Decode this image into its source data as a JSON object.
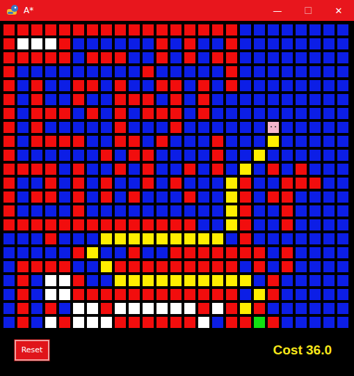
{
  "window": {
    "title": "A*",
    "controls": [
      "—",
      "☐",
      "✕"
    ]
  },
  "grid": {
    "legend": {
      "R": "wall",
      "B": "open",
      "Y": "path",
      "W": "visited",
      "S": "start",
      "E": "end"
    },
    "rows": [
      "RRRRRRRRRRRRRRRRRBBBBBBBB",
      "RWWWRBBBBBBRBRBBRBBBBBBBB",
      "RRRRRBRRRBBRBRBRRBBBBBBBB",
      "RBBBBBBBBBRBBBBBRBBBBBBBB",
      "RBRBBRRBRBBRRBRBRBBBBBBBB",
      "RBRBBRBBRRRBRBRBBBBBBBBBB",
      "RBRRRBRBRBRRRBRBBBBBBBBBB",
      "RBRBBBBBRBBBRBBBBBBSBBBBB",
      "RBRRRRBBRRBRBBBRBBBYBBBBB",
      "RBBBBBBRBRRBBBBRBBYBBBBBB",
      "RRRRBRBBRBRBBRBRBYBRBRBBB",
      "RBBRBRBRBBRBRBBBYRBBRRRBB",
      "RBRRBRBRBRBBBRBBYRBRRBBBB",
      "RBBBBRBBBBBBBBBBYRBBRBBBB",
      "RRRRRRRRRRRRRRBBYRBBRBBBB",
      "BBBRBBBYYYYYYYYYBRBBBBBBB",
      "BBBBBRYBBRBBRRRRRRRBRBBBB",
      "BRRRRBBYRRRRRRRRRBRBRBBBB",
      "BRBWWRBBYYYYYYYYYYBRBBBBB",
      "BRBWWRRRRRRRRRRRRBYRBBBBB",
      "BRBRBWWRWWWWWWRWRYRBBBBBB",
      "BRBWRWWWRRRRRRWBRRERBBBBB"
    ]
  },
  "reset_button": {
    "label": "Reset"
  },
  "cost": "Cost 36.0"
}
